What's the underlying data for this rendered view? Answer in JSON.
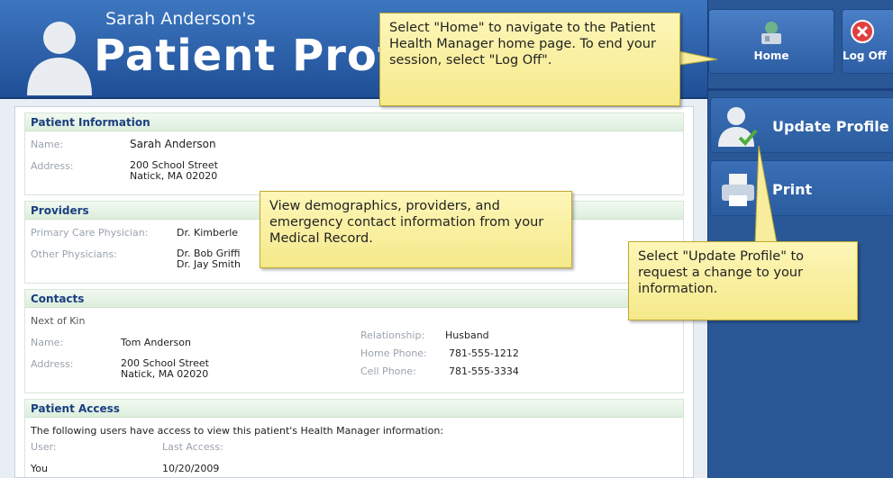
{
  "header": {
    "subtitle": "Sarah Anderson's",
    "title": "Patient Profile"
  },
  "nav": {
    "home_label": "Home",
    "logoff_label": "Log Off",
    "update_label": "Update Profile",
    "print_label": "Print"
  },
  "patient_info": {
    "heading": "Patient Information",
    "name_label": "Name:",
    "name_value": "Sarah Anderson",
    "address_label": "Address:",
    "address_line1": "200 School Street",
    "address_line2": "Natick, MA 02020"
  },
  "providers": {
    "heading": "Providers",
    "pcp_label": "Primary Care Physician:",
    "pcp_value": "Dr. Kimberle",
    "other_label": "Other Physicians:",
    "other_value1": "Dr. Bob Griffi",
    "other_value2": "Dr. Jay Smith"
  },
  "contacts": {
    "heading": "Contacts",
    "next_of_kin": "Next of Kin",
    "name_label": "Name:",
    "name_value": "Tom Anderson",
    "address_label": "Address:",
    "address_line1": "200 School Street",
    "address_line2": "Natick, MA 02020",
    "relationship_label": "Relationship:",
    "relationship_value": "Husband",
    "home_phone_label": "Home Phone:",
    "home_phone_value": "781-555-1212",
    "cell_phone_label": "Cell Phone:",
    "cell_phone_value": "781-555-3334"
  },
  "access": {
    "heading": "Patient Access",
    "description": "The following users have access to view this patient's Health Manager information:",
    "user_col": "User:",
    "last_access_col": "Last Access:",
    "rows": [
      {
        "user": "You",
        "last_access": "10/20/2009"
      }
    ]
  },
  "callouts": {
    "home": "Select \"Home\" to navigate to the Patient Health Manager home page. To end your session, select \"Log Off\".",
    "view": "View demographics, providers, and emergency contact information from your Medical Record.",
    "update": "Select \"Update Profile\" to request a change to your information."
  }
}
